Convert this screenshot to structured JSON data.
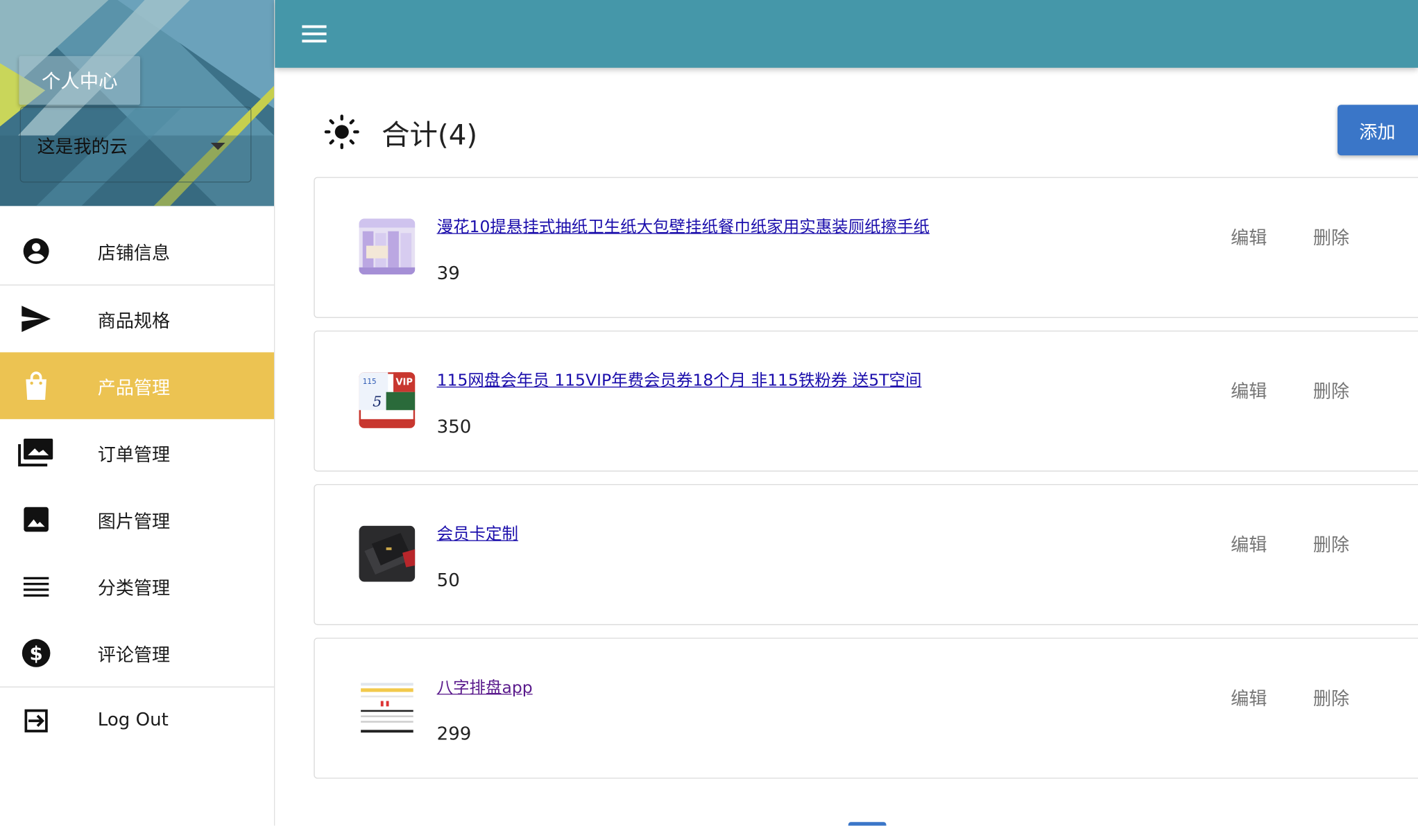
{
  "drawer": {
    "profile_button": "个人中心",
    "account_select": "这是我的云",
    "items": [
      {
        "label": "店铺信息",
        "icon": "account-circle-icon"
      },
      {
        "label": "商品规格",
        "icon": "send-icon"
      },
      {
        "label": "产品管理",
        "icon": "shopping-bag-icon",
        "active": true
      },
      {
        "label": "订单管理",
        "icon": "photo-library-icon"
      },
      {
        "label": "图片管理",
        "icon": "image-icon"
      },
      {
        "label": "分类管理",
        "icon": "list-icon"
      },
      {
        "label": "评论管理",
        "icon": "dollar-circle-icon"
      }
    ],
    "logout": {
      "label": "Log Out",
      "icon": "logout-icon"
    }
  },
  "header": {
    "menu_icon": "menu-icon",
    "color": "#4597a9"
  },
  "main": {
    "title": "合计(4)",
    "title_icon": "sun-icon",
    "add_label": "添加",
    "edit_label": "编辑",
    "delete_label": "删除",
    "products": [
      {
        "name": "漫花10提悬挂式抽纸卫生纸大包壁挂纸餐巾纸家用实惠装厕纸擦手纸",
        "price": "39"
      },
      {
        "name": "115网盘会年员 115VIP年费会员券18个月 非115铁粉券 送5T空间",
        "price": "350"
      },
      {
        "name": "会员卡定制",
        "price": "50"
      },
      {
        "name": "八字排盘app",
        "price": "299"
      }
    ]
  },
  "colors": {
    "accent": "#ecc352",
    "primary": "#4597a9",
    "button": "#3a76c8"
  }
}
